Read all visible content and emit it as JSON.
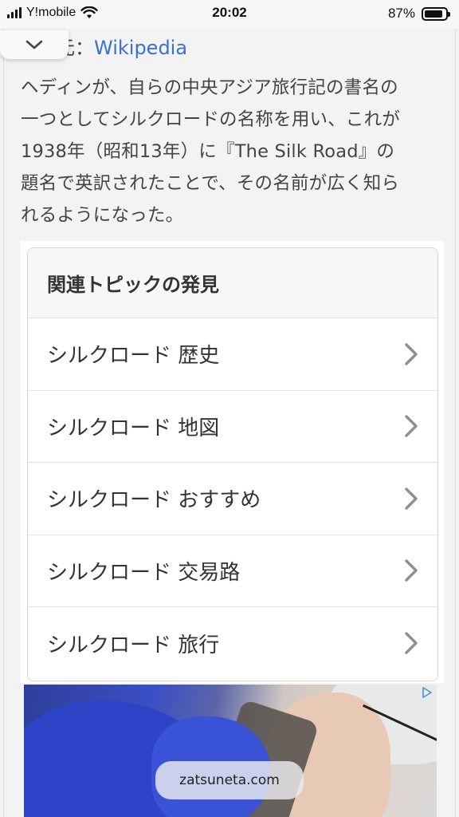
{
  "status_bar": {
    "carrier": "Y!mobile",
    "time": "20:02",
    "battery_percent": "87%",
    "battery_level": 0.87
  },
  "source": {
    "prefix": "元：",
    "link_label": "Wikipedia"
  },
  "paragraph": {
    "lines": [
      "ヘディンが、自らの中央アジア旅行記の書名の",
      "一つとしてシルクロードの名称を用い、これが",
      "1938年（昭和13年）に『The Silk Road』の",
      "題名で英訳されたことで、その名前が広く知ら",
      "れるようになった。"
    ]
  },
  "related_topics": {
    "header": "関連トピックの発見",
    "items": [
      {
        "label": "シルクロード 歴史"
      },
      {
        "label": "シルクロード 地図"
      },
      {
        "label": "シルクロード おすすめ"
      },
      {
        "label": "シルクロード 交易路"
      },
      {
        "label": "シルクロード 旅行"
      }
    ]
  },
  "watermark": {
    "text": "zatsuneta.com"
  },
  "icons": {
    "collapse": "chevron-down-icon",
    "item_arrow": "chevron-right-icon",
    "wifi": "wifi-icon",
    "signal": "cellular-signal-icon",
    "battery": "battery-icon",
    "ad_choices": "ad-choices-icon"
  },
  "colors": {
    "link": "#3a72c9",
    "chevron": "#8e8e93"
  }
}
